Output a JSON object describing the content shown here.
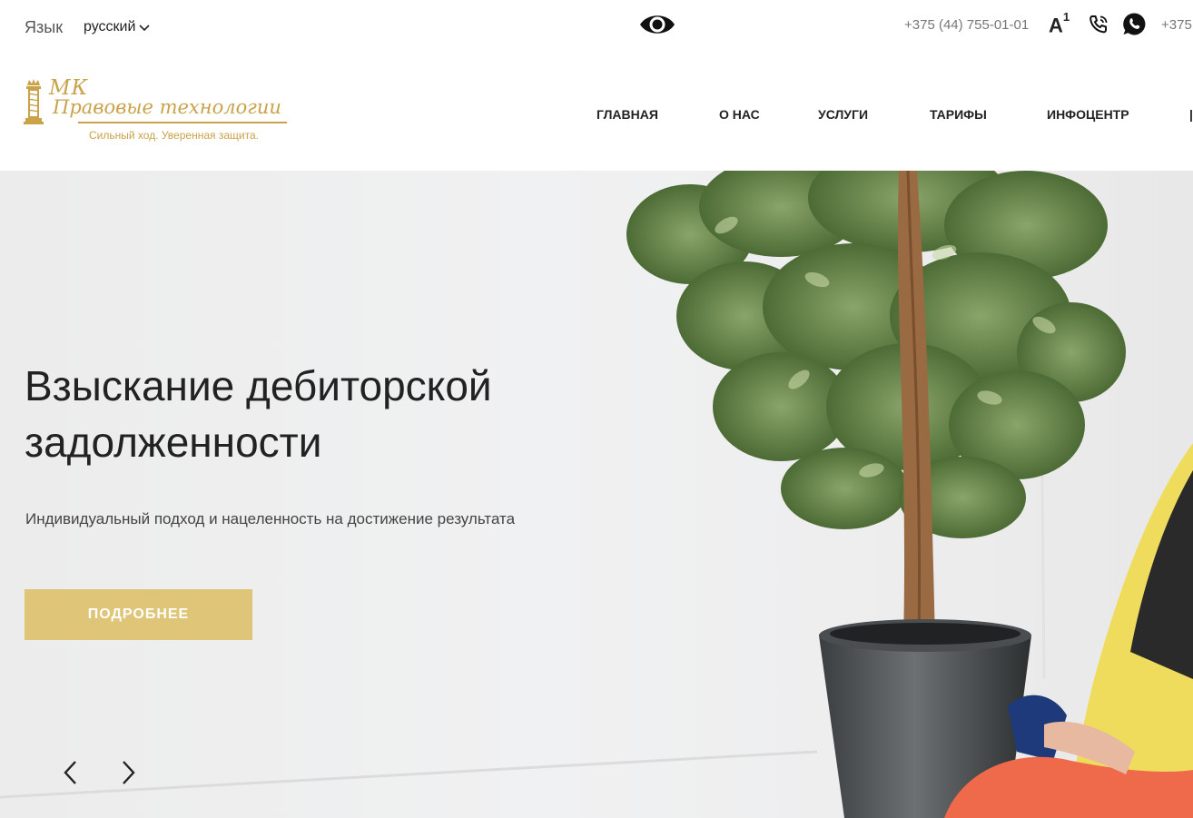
{
  "topbar": {
    "lang_label": "Язык",
    "lang_value": "русский",
    "phone_primary": "+375 (44) 755-01-01",
    "font_size_label": "A",
    "font_size_sup": "1",
    "phone_secondary": "+375"
  },
  "logo": {
    "monogram": "МК",
    "name": "Правовые технологии",
    "tagline": "Сильный ход. Уверенная защита."
  },
  "nav": {
    "items": [
      {
        "label": "ГЛАВНАЯ"
      },
      {
        "label": "О НАС"
      },
      {
        "label": "УСЛУГИ"
      },
      {
        "label": "ТАРИФЫ"
      },
      {
        "label": "ИНФОЦЕНТР"
      }
    ]
  },
  "hero": {
    "title": "Взыскание дебиторской задолженности",
    "subtitle": "Индивидуальный подход и нацеленность на достижение результата",
    "button_label": "ПОДРОБНЕЕ"
  },
  "colors": {
    "accent_gold": "#dfc577",
    "logo_gold": "#c9a24a"
  }
}
